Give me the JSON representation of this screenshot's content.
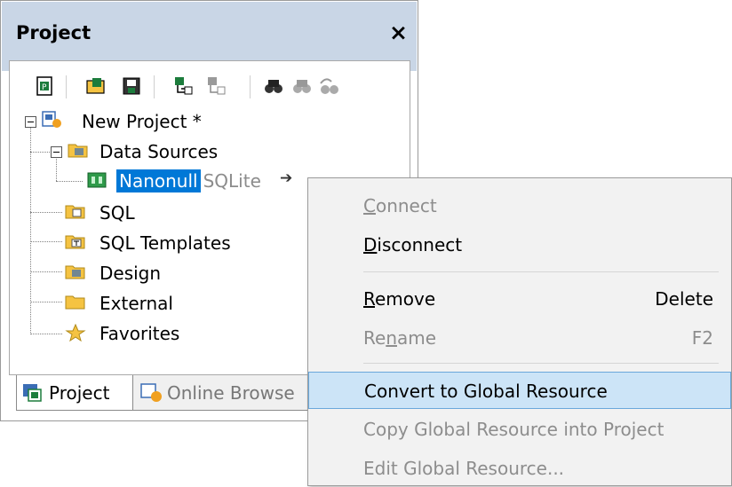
{
  "panel": {
    "title": "Project",
    "close_glyph": "×"
  },
  "toolbar": {
    "icons": [
      "new-project-icon",
      "open-project-icon",
      "save-project-icon",
      "add-to-project-icon",
      "add-item-icon",
      "find-icon",
      "find-next-icon",
      "find-previous-icon"
    ]
  },
  "tree": {
    "root": {
      "label": "New Project *"
    },
    "data_sources": {
      "label": "Data Sources"
    },
    "nanonull": {
      "label": "Nanonull",
      "suffix": "SQLite"
    },
    "sql": {
      "label": "SQL"
    },
    "sql_templates": {
      "label": "SQL Templates"
    },
    "design": {
      "label": "Design"
    },
    "external": {
      "label": "External"
    },
    "favorites": {
      "label": "Favorites"
    }
  },
  "tabs": {
    "project": "Project",
    "online": "Online Browse"
  },
  "context_menu": {
    "connect": {
      "prefix": "",
      "accel": "C",
      "rest": "onnect"
    },
    "disconnect": {
      "prefix": "",
      "accel": "D",
      "rest": "isconnect"
    },
    "remove": {
      "prefix": "",
      "accel": "R",
      "rest": "emove",
      "shortcut": "Delete"
    },
    "rename": {
      "prefix": "Re",
      "accel": "n",
      "rest": "ame",
      "shortcut": "F2"
    },
    "convert": "Convert to Global Resource",
    "copy_global": "Copy Global Resource into Project",
    "edit_global": "Edit Global Resource..."
  },
  "colors": {
    "selection": "#0078d7",
    "menu_highlight": "#cce4f7",
    "titlebar": "#c9d6e6",
    "disabled_text": "#8d8d8d"
  }
}
